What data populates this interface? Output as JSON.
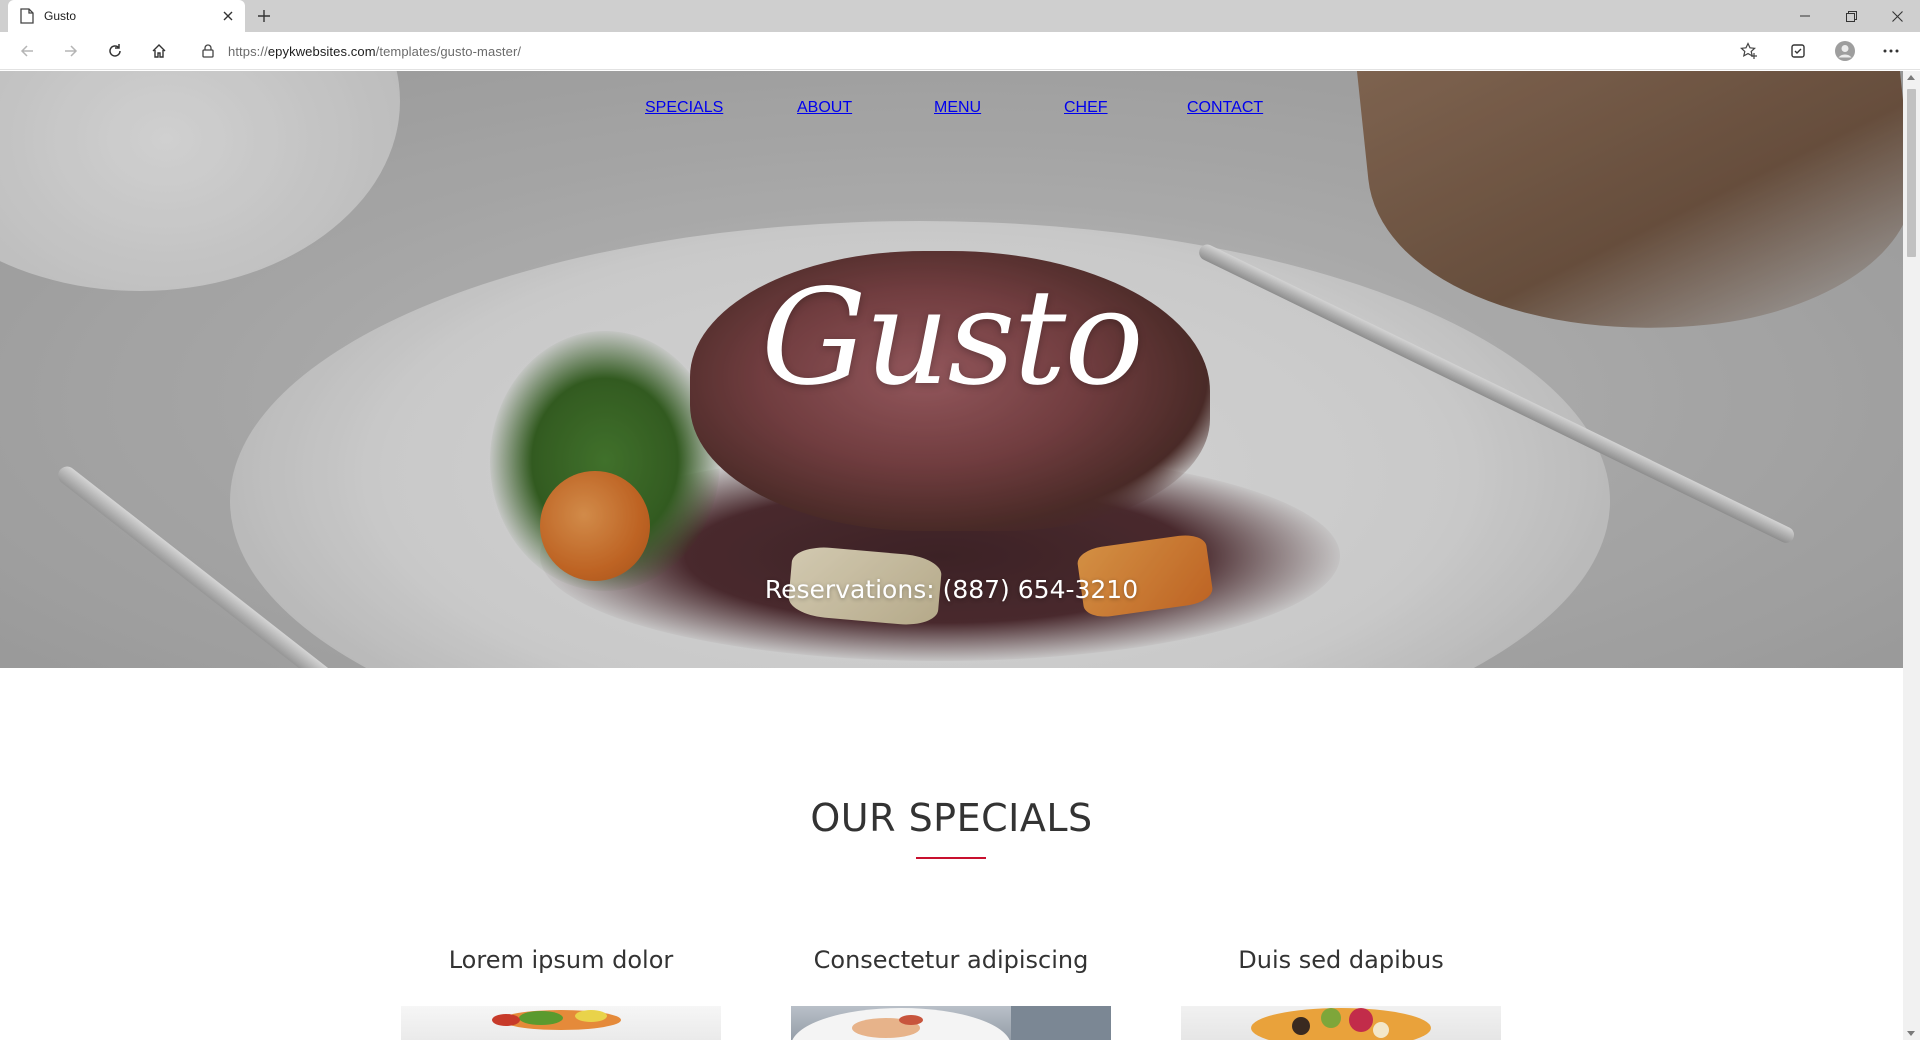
{
  "browser": {
    "tab_title": "Gusto",
    "url_prefix": "https://",
    "url_host": "epykwebsites.com",
    "url_path": "/templates/gusto-master/"
  },
  "nav": {
    "items": [
      "SPECIALS",
      "ABOUT",
      "MENU",
      "CHEF",
      "CONTACT"
    ]
  },
  "hero": {
    "logo": "Gusto",
    "reservations": "Reservations: (887) 654-3210"
  },
  "specials": {
    "title": "OUR SPECIALS",
    "items": [
      {
        "title": "Lorem ipsum dolor"
      },
      {
        "title": "Consectetur adipiscing"
      },
      {
        "title": "Duis sed dapibus"
      }
    ]
  },
  "colors": {
    "accent": "#c8102e",
    "heading": "#333333"
  }
}
